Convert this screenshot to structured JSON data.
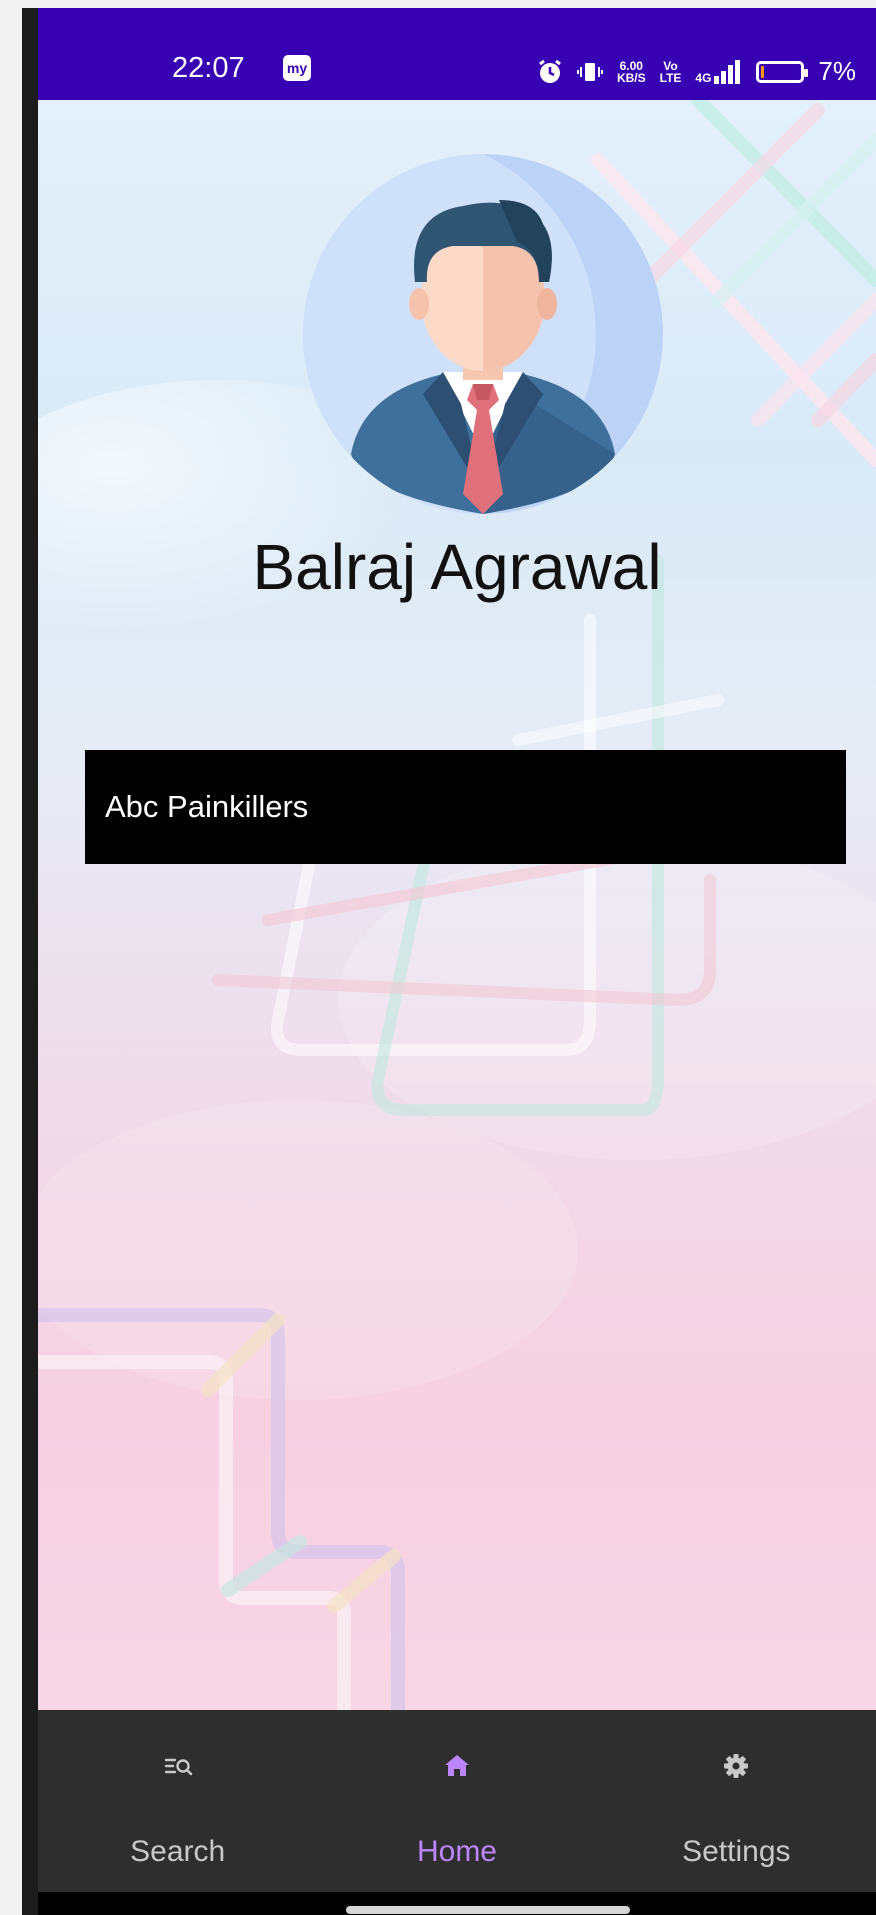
{
  "status_bar": {
    "time": "22:07",
    "app_badge": "my",
    "network_speed_value": "6.00",
    "network_speed_unit": "KB/S",
    "volte_top": "Vo",
    "volte_bottom": "LTE",
    "signal_label": "4G",
    "battery_percent": "7%",
    "battery_level": 0.07,
    "background_color": "#3700b3"
  },
  "profile": {
    "avatar_icon": "businessman-avatar-icon",
    "name": "Balraj Agrawal"
  },
  "list": {
    "items": [
      {
        "label": "Abc Painkillers"
      }
    ]
  },
  "bottom_nav": {
    "active_color": "#bb86fc",
    "items": [
      {
        "label": "Search",
        "icon": "search-list-icon",
        "active": false
      },
      {
        "label": "Home",
        "icon": "home-icon",
        "active": true
      },
      {
        "label": "Settings",
        "icon": "gear-icon",
        "active": false
      }
    ]
  }
}
